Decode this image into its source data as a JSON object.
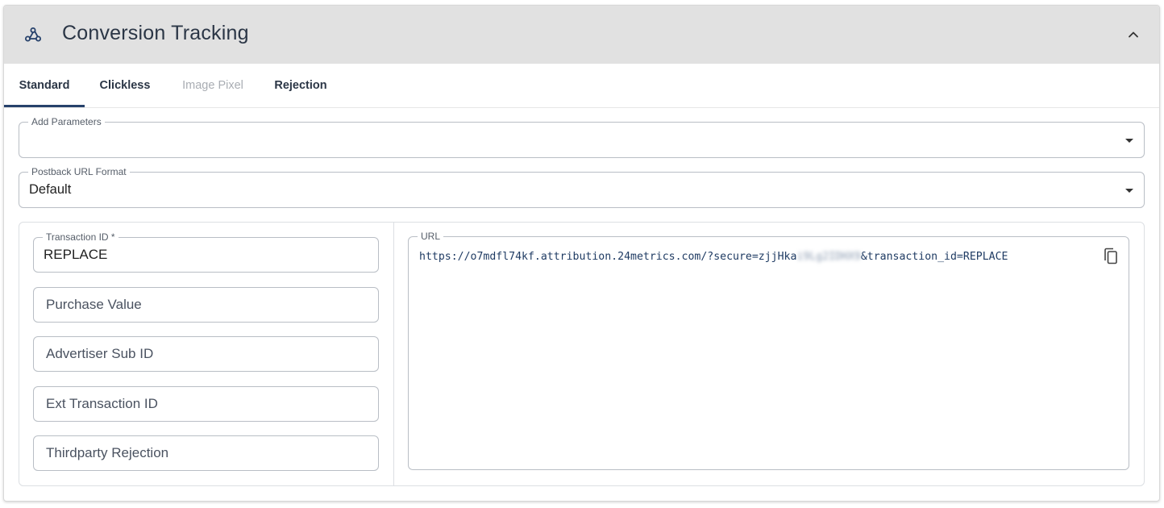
{
  "header": {
    "title": "Conversion Tracking",
    "icon": "webhook-icon",
    "collapse_icon": "chevron-up-icon"
  },
  "tabs": [
    {
      "label": "Standard",
      "active": true,
      "disabled": false
    },
    {
      "label": "Clickless",
      "active": false,
      "disabled": false
    },
    {
      "label": "Image Pixel",
      "active": false,
      "disabled": true
    },
    {
      "label": "Rejection",
      "active": false,
      "disabled": false
    }
  ],
  "add_parameters": {
    "label": "Add Parameters",
    "value": ""
  },
  "postback_format": {
    "label": "Postback URL Format",
    "value": "Default"
  },
  "fields": {
    "transaction_id": {
      "label": "Transaction ID *",
      "value": "REPLACE"
    },
    "purchase_value": {
      "placeholder": "Purchase Value"
    },
    "advertiser_sub_id": {
      "placeholder": "Advertiser Sub ID"
    },
    "ext_transaction_id": {
      "placeholder": "Ext Transaction ID"
    },
    "thirdparty_rejection": {
      "placeholder": "Thirdparty Rejection"
    }
  },
  "url": {
    "label": "URL",
    "prefix": "https://o7mdfl74kf.attribution.24metrics.com/?secure=zjjHka",
    "redacted": "i9Lg2IDHX9",
    "suffix": "&transaction_id=REPLACE",
    "copy_icon": "copy-icon"
  },
  "colors": {
    "header_bg": "#e1e1e1",
    "accent": "#26416b",
    "url_text": "#1f3b63"
  }
}
